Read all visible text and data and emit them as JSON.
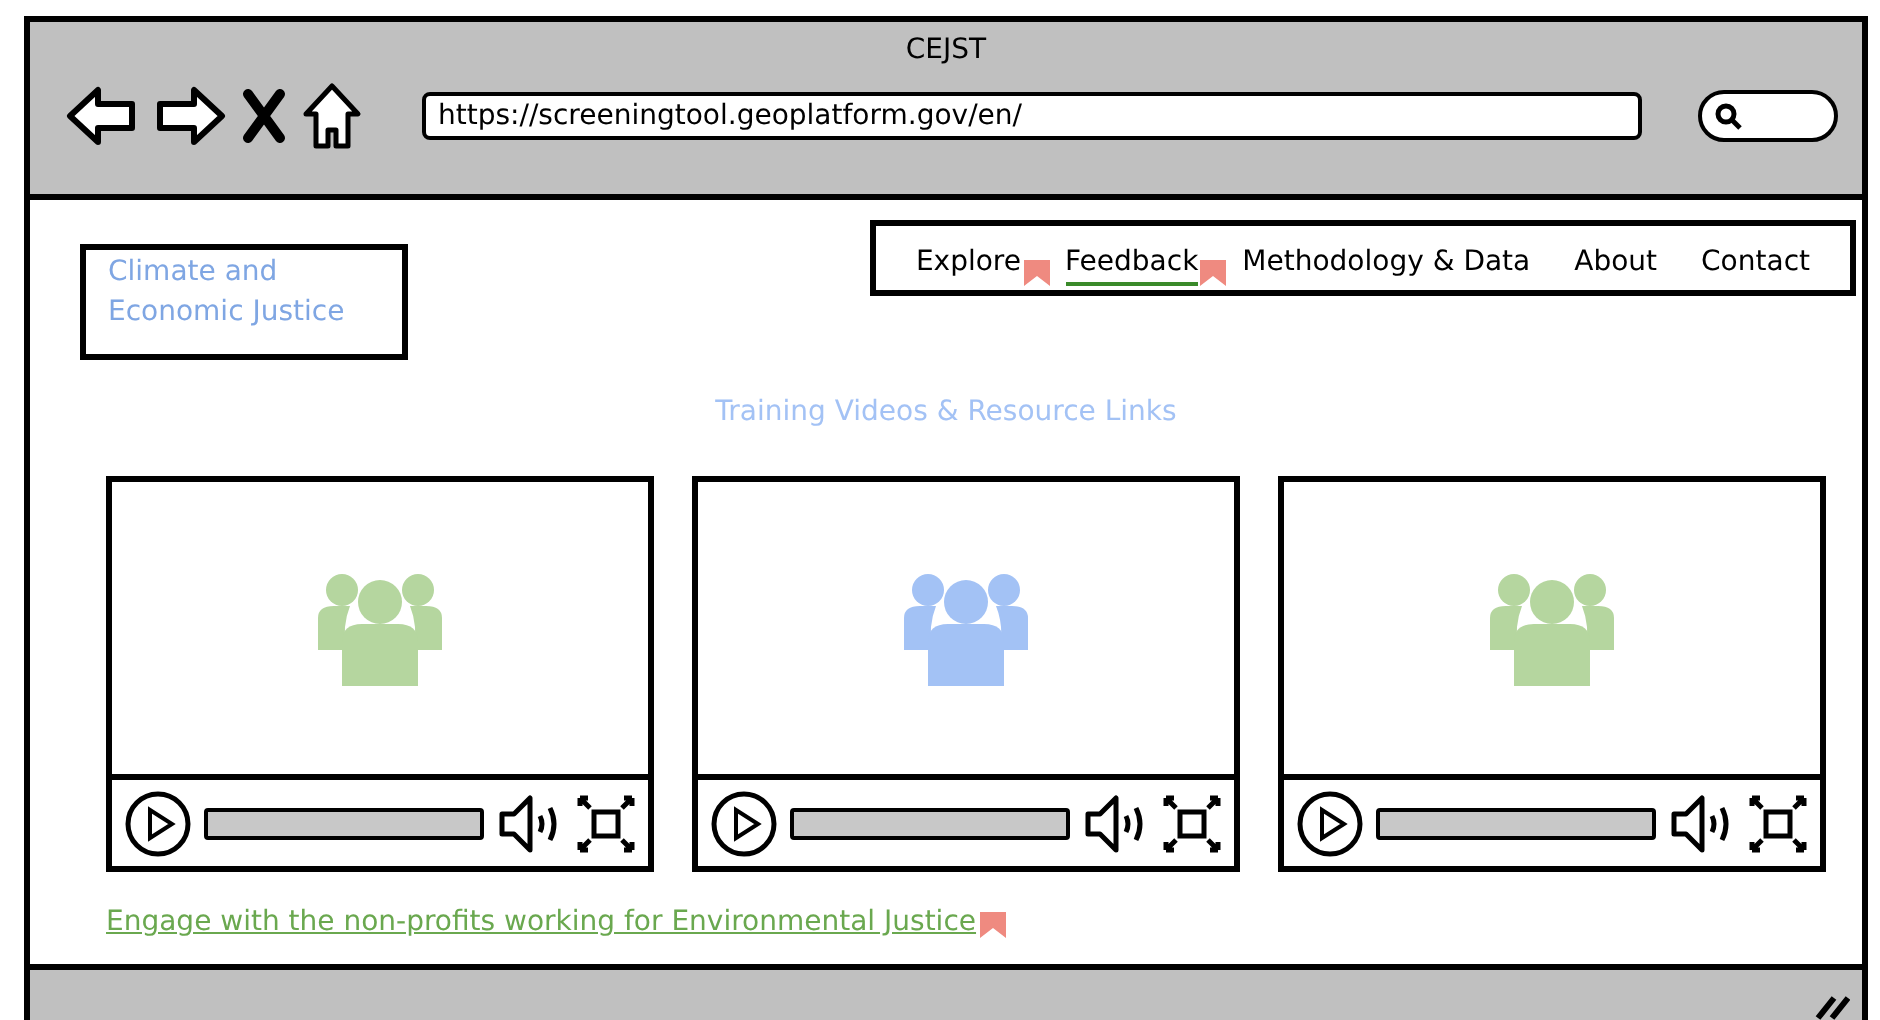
{
  "window": {
    "title": "CEJST",
    "url": "https://screeningtool.geoplatform.gov/en/"
  },
  "logo": {
    "lines": [
      "Climate and",
      "Economic Justice"
    ]
  },
  "nav": [
    {
      "label": "Explore",
      "selected": false,
      "flagged": true
    },
    {
      "label": "Feedback",
      "selected": true,
      "flagged": true
    },
    {
      "label": "Methodology & Data",
      "selected": false,
      "flagged": false
    },
    {
      "label": "About",
      "selected": false,
      "flagged": false
    },
    {
      "label": "Contact",
      "selected": false,
      "flagged": false
    }
  ],
  "heading": "Training Videos & Resource Links",
  "videos": [
    {
      "color": "#b5d69f"
    },
    {
      "color": "#a3c2f5"
    },
    {
      "color": "#b5d69f"
    }
  ],
  "link": {
    "label": "Engage with the non-profits working for Environmental Justice",
    "flagged": true
  }
}
